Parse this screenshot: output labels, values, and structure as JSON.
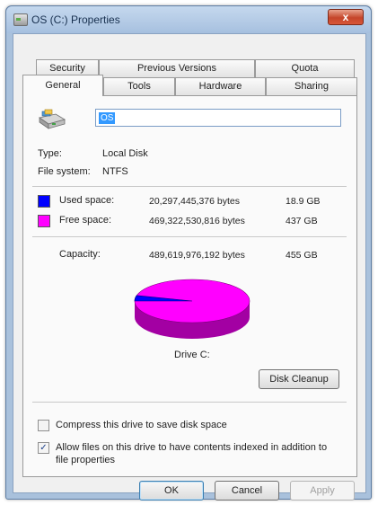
{
  "window": {
    "title": "OS (C:) Properties",
    "close_glyph": "x"
  },
  "tabs_row1": [
    "Security",
    "Previous Versions",
    "Quota"
  ],
  "tabs_row2": [
    "General",
    "Tools",
    "Hardware",
    "Sharing"
  ],
  "active_tab": "General",
  "general": {
    "drive_name": "OS",
    "type_label": "Type:",
    "type_value": "Local Disk",
    "fs_label": "File system:",
    "fs_value": "NTFS",
    "used": {
      "label": "Used space:",
      "bytes": "20,297,445,376 bytes",
      "size": "18.9 GB",
      "color": "#0000ff"
    },
    "free": {
      "label": "Free space:",
      "bytes": "469,322,530,816 bytes",
      "size": "437 GB",
      "color": "#ff00ff"
    },
    "capacity": {
      "label": "Capacity:",
      "bytes": "489,619,976,192 bytes",
      "size": "455 GB"
    },
    "drive_caption": "Drive C:",
    "cleanup_label": "Disk Cleanup",
    "compress_label": "Compress this drive to save disk space",
    "compress_checked": false,
    "index_label_line1": "Allow files on this drive to have contents indexed in addition to",
    "index_label_line2": "file properties",
    "index_checked": true,
    "check_glyph": "✓"
  },
  "buttons": {
    "ok": "OK",
    "cancel": "Cancel",
    "apply": "Apply"
  }
}
